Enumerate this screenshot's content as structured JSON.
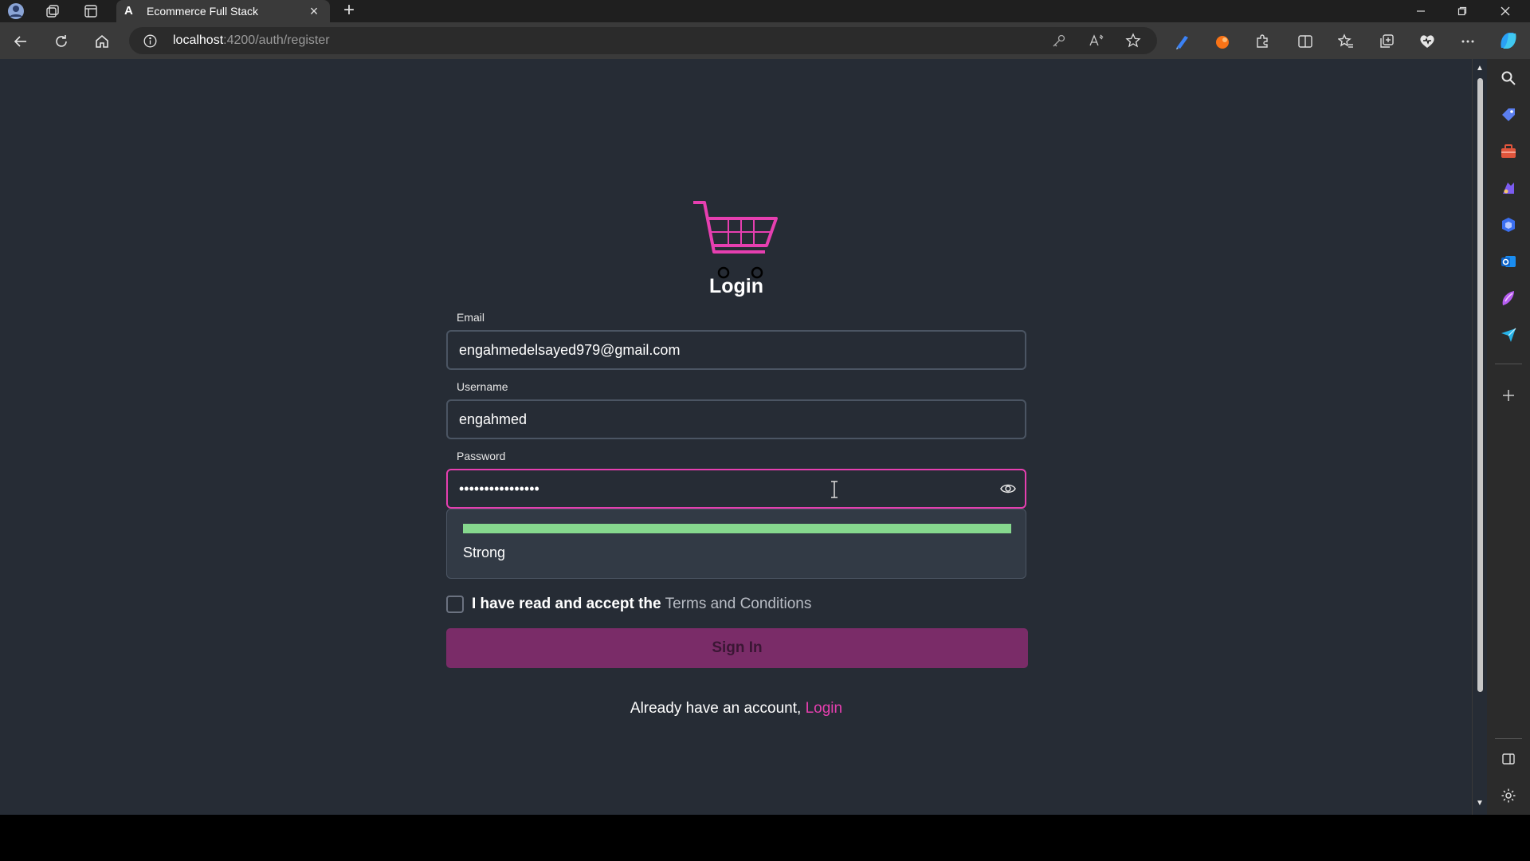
{
  "browser": {
    "tab_title": "Ecommerce Full Stack",
    "tab_favicon": "A",
    "url_host": "localhost",
    "url_path": ":4200/auth/register"
  },
  "page": {
    "title": "Login",
    "email": {
      "label": "Email",
      "value": "engahmedelsayed979@gmail.com"
    },
    "username": {
      "label": "Username",
      "value": "engahmed"
    },
    "password": {
      "label": "Password",
      "masked_value": "••••••••••••••••"
    },
    "strength": {
      "label": "Strong",
      "level": 1.0,
      "color": "#86d88e"
    },
    "terms": {
      "text": "I have read and accept the",
      "link": "Terms and Conditions",
      "checked": false
    },
    "submit_label": "Sign In",
    "footer": {
      "text": "Already have an account,",
      "link": "Login"
    }
  },
  "colors": {
    "accent": "#e63fb0",
    "background": "#262c35",
    "button": "#7a2c68"
  }
}
